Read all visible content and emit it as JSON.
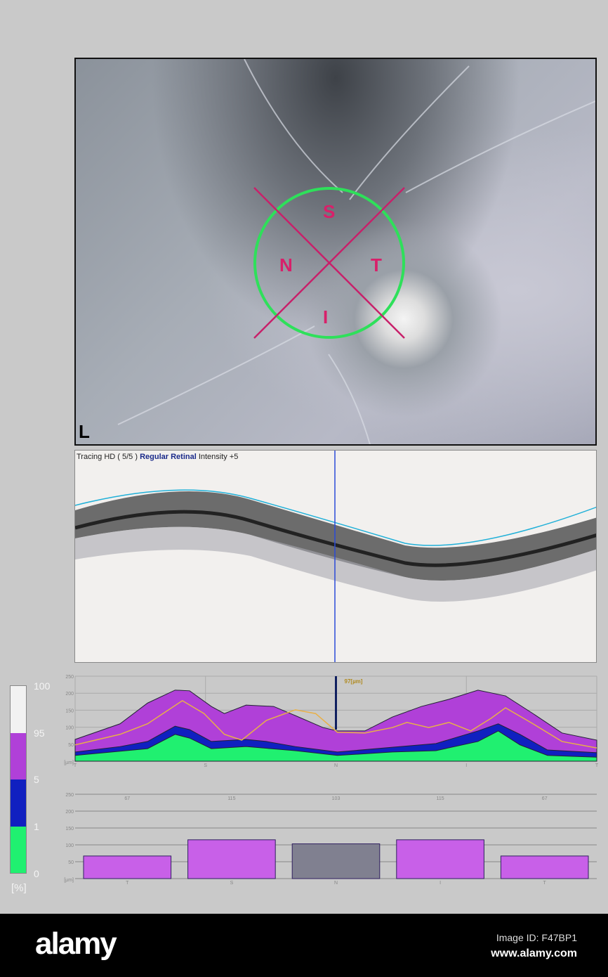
{
  "fundus": {
    "eye": "L",
    "sectors": [
      "S",
      "N",
      "T",
      "I"
    ],
    "colors": {
      "circle": "#2ee05a",
      "cross": "#c8206a",
      "sector_text": "#d8206a"
    }
  },
  "oct": {
    "tracing": "Tracing HD ( 5/5 )",
    "mode": "Regular Retinal",
    "intensity": "Intensity +5"
  },
  "legend": {
    "ticks": [
      "100",
      "95",
      "5",
      "1",
      "0"
    ],
    "unit": "[%]",
    "colors": {
      "above95": "#f2f2f2",
      "normal": "#b040d8",
      "borderline": "#1020c0",
      "below1": "#20f070"
    }
  },
  "chart_data": [
    {
      "type": "area",
      "title": "RNFL thickness profile",
      "ylabel": "[µm]",
      "ylim": [
        0,
        250
      ],
      "yticks": [
        50,
        100,
        150,
        200,
        250
      ],
      "xlim": [
        0,
        360
      ],
      "xtick_labels": [
        "T",
        "S",
        "N",
        "I",
        "T"
      ],
      "marker": {
        "x": 180,
        "label": "97[µm]"
      },
      "x_p95": [
        0,
        31,
        50,
        69,
        79,
        94,
        103,
        118,
        137,
        152,
        171,
        181,
        200,
        219,
        239,
        258,
        278,
        297,
        316,
        336,
        360
      ],
      "p95": [
        64,
        110,
        171,
        209,
        207,
        161,
        140,
        165,
        161,
        134,
        99,
        89,
        89,
        130,
        161,
        182,
        209,
        192,
        140,
        83,
        62
      ],
      "x_p5": [
        0,
        31,
        50,
        69,
        79,
        94,
        118,
        132,
        152,
        181,
        219,
        249,
        278,
        292,
        307,
        326,
        360
      ],
      "p5": [
        27,
        43,
        58,
        103,
        93,
        58,
        64,
        58,
        43,
        27,
        41,
        52,
        89,
        110,
        79,
        33,
        25
      ],
      "x_p1": [
        0,
        50,
        69,
        79,
        94,
        118,
        152,
        181,
        219,
        249,
        278,
        292,
        307,
        326,
        360
      ],
      "p1": [
        17,
        37,
        79,
        68,
        37,
        43,
        31,
        17,
        27,
        31,
        58,
        89,
        48,
        17,
        12
      ],
      "x_patient": [
        0,
        31,
        50,
        74,
        89,
        103,
        115,
        132,
        152,
        166,
        181,
        200,
        219,
        229,
        244,
        258,
        273,
        287,
        297,
        316,
        336,
        360
      ],
      "patient": [
        48,
        79,
        110,
        178,
        140,
        79,
        62,
        120,
        151,
        140,
        85,
        83,
        99,
        114,
        99,
        114,
        89,
        126,
        157,
        110,
        58,
        39
      ]
    },
    {
      "type": "bar",
      "ylabel": "[µm]",
      "ylim": [
        0,
        250
      ],
      "yticks": [
        50,
        100,
        150,
        200,
        250
      ],
      "categories": [
        "T",
        "S",
        "N",
        "I",
        "T"
      ],
      "values": [
        67,
        115,
        103,
        115,
        67
      ],
      "value_labels": [
        "67",
        "115",
        "103",
        "115",
        "67"
      ],
      "colors": [
        "#c860e8",
        "#c860e8",
        "#808090",
        "#c860e8",
        "#c860e8"
      ]
    }
  ],
  "footer": {
    "logo": "alamy",
    "image_id": "Image ID: F47BP1",
    "site": "www.alamy.com"
  }
}
